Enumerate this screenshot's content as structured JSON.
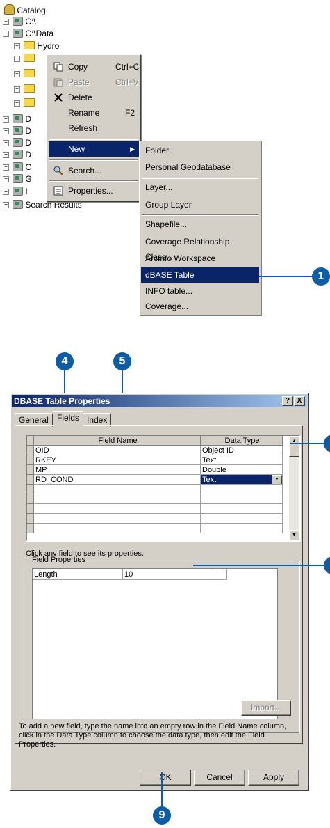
{
  "tree": {
    "root": "Catalog",
    "items": [
      "C:\\",
      "C:\\Data",
      "Hydro",
      "Search Results"
    ],
    "partial": [
      "D",
      "D",
      "D",
      "D",
      "C",
      "G",
      "I"
    ]
  },
  "context_menu": {
    "items": [
      {
        "label": "Copy",
        "shortcut": "Ctrl+C",
        "icon": "copy-icon"
      },
      {
        "label": "Paste",
        "shortcut": "Ctrl+V",
        "icon": "paste-icon"
      },
      {
        "label": "Delete",
        "icon": "delete-x-icon"
      },
      {
        "label": "Rename",
        "shortcut": "F2"
      },
      {
        "label": "Refresh"
      },
      {
        "label": "New",
        "submenu_arrow": "▶"
      },
      {
        "label": "Search...",
        "icon": "search-icon"
      },
      {
        "label": "Properties...",
        "icon": "properties-icon"
      }
    ]
  },
  "new_submenu": {
    "items": [
      "Folder",
      "Personal Geodatabase",
      "Layer...",
      "Group Layer",
      "Shapefile...",
      "Coverage Relationship Class...",
      "ArcInfo Workspace",
      "dBASE Table",
      "INFO table...",
      "Coverage..."
    ],
    "highlighted": "dBASE Table"
  },
  "callouts": {
    "c1": "1",
    "c4": "4",
    "c5": "5",
    "c9": "9"
  },
  "dialog": {
    "title": "DBASE Table Properties",
    "help_btn": "?",
    "close_btn": "X",
    "tabs": [
      "General",
      "Fields",
      "Index"
    ],
    "active_tab": "Fields",
    "columns": [
      "Field Name",
      "Data Type"
    ],
    "rows": [
      [
        "OID",
        "Object ID"
      ],
      [
        "RKEY",
        "Text"
      ],
      [
        "MP",
        "Double"
      ],
      [
        "RD_COND",
        "Text"
      ]
    ],
    "hint": "Click any field to see its properties.",
    "field_properties_label": "Field Properties",
    "properties": [
      [
        "Length",
        "10"
      ]
    ],
    "import_label": "Import...",
    "instructions": "To add a new field, type the name into an empty row in the Field Name column, click in the Data Type column to choose the data type, then edit the Field Properties.",
    "ok_label": "OK",
    "cancel_label": "Cancel",
    "apply_label": "Apply"
  }
}
